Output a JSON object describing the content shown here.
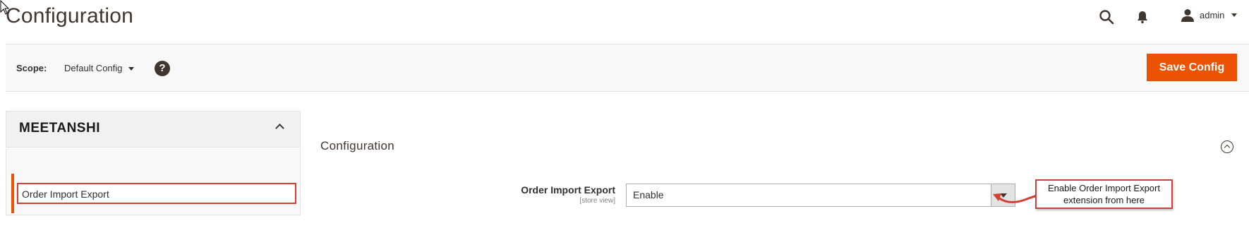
{
  "header": {
    "title": "Configuration",
    "user_label": "admin",
    "icons": [
      "search-icon",
      "bell-icon",
      "user-icon"
    ]
  },
  "scope_bar": {
    "scope_label": "Scope:",
    "scope_value": "Default Config",
    "help_symbol": "?",
    "save_label": "Save Config"
  },
  "sidebar": {
    "brand": "MEETANSHI",
    "items": [
      {
        "label": "Order Import Export",
        "active": true
      }
    ]
  },
  "main": {
    "section_title": "Configuration",
    "field": {
      "label": "Order Import Export",
      "scope_note": "[store view]",
      "value": "Enable"
    },
    "callout": "Enable Order Import Export extension from here"
  },
  "colors": {
    "accent": "#eb5202",
    "highlight_border": "#d33f32",
    "text": "#303030"
  }
}
